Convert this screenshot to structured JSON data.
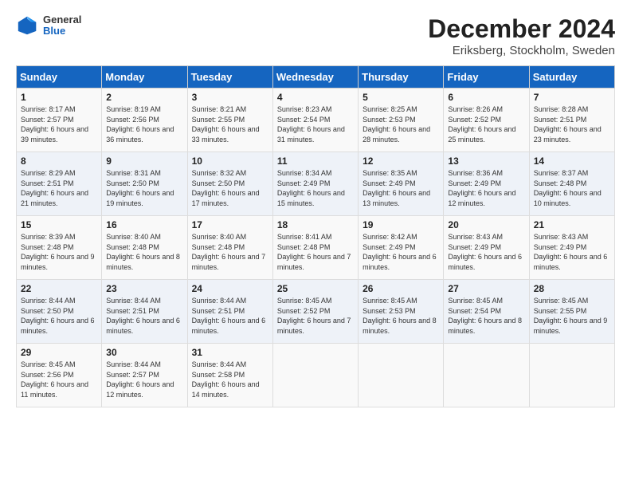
{
  "header": {
    "logo_general": "General",
    "logo_blue": "Blue",
    "main_title": "December 2024",
    "sub_title": "Eriksberg, Stockholm, Sweden"
  },
  "calendar": {
    "days_of_week": [
      "Sunday",
      "Monday",
      "Tuesday",
      "Wednesday",
      "Thursday",
      "Friday",
      "Saturday"
    ],
    "weeks": [
      [
        {
          "day": "1",
          "sunrise": "Sunrise: 8:17 AM",
          "sunset": "Sunset: 2:57 PM",
          "daylight": "Daylight: 6 hours and 39 minutes."
        },
        {
          "day": "2",
          "sunrise": "Sunrise: 8:19 AM",
          "sunset": "Sunset: 2:56 PM",
          "daylight": "Daylight: 6 hours and 36 minutes."
        },
        {
          "day": "3",
          "sunrise": "Sunrise: 8:21 AM",
          "sunset": "Sunset: 2:55 PM",
          "daylight": "Daylight: 6 hours and 33 minutes."
        },
        {
          "day": "4",
          "sunrise": "Sunrise: 8:23 AM",
          "sunset": "Sunset: 2:54 PM",
          "daylight": "Daylight: 6 hours and 31 minutes."
        },
        {
          "day": "5",
          "sunrise": "Sunrise: 8:25 AM",
          "sunset": "Sunset: 2:53 PM",
          "daylight": "Daylight: 6 hours and 28 minutes."
        },
        {
          "day": "6",
          "sunrise": "Sunrise: 8:26 AM",
          "sunset": "Sunset: 2:52 PM",
          "daylight": "Daylight: 6 hours and 25 minutes."
        },
        {
          "day": "7",
          "sunrise": "Sunrise: 8:28 AM",
          "sunset": "Sunset: 2:51 PM",
          "daylight": "Daylight: 6 hours and 23 minutes."
        }
      ],
      [
        {
          "day": "8",
          "sunrise": "Sunrise: 8:29 AM",
          "sunset": "Sunset: 2:51 PM",
          "daylight": "Daylight: 6 hours and 21 minutes."
        },
        {
          "day": "9",
          "sunrise": "Sunrise: 8:31 AM",
          "sunset": "Sunset: 2:50 PM",
          "daylight": "Daylight: 6 hours and 19 minutes."
        },
        {
          "day": "10",
          "sunrise": "Sunrise: 8:32 AM",
          "sunset": "Sunset: 2:50 PM",
          "daylight": "Daylight: 6 hours and 17 minutes."
        },
        {
          "day": "11",
          "sunrise": "Sunrise: 8:34 AM",
          "sunset": "Sunset: 2:49 PM",
          "daylight": "Daylight: 6 hours and 15 minutes."
        },
        {
          "day": "12",
          "sunrise": "Sunrise: 8:35 AM",
          "sunset": "Sunset: 2:49 PM",
          "daylight": "Daylight: 6 hours and 13 minutes."
        },
        {
          "day": "13",
          "sunrise": "Sunrise: 8:36 AM",
          "sunset": "Sunset: 2:49 PM",
          "daylight": "Daylight: 6 hours and 12 minutes."
        },
        {
          "day": "14",
          "sunrise": "Sunrise: 8:37 AM",
          "sunset": "Sunset: 2:48 PM",
          "daylight": "Daylight: 6 hours and 10 minutes."
        }
      ],
      [
        {
          "day": "15",
          "sunrise": "Sunrise: 8:39 AM",
          "sunset": "Sunset: 2:48 PM",
          "daylight": "Daylight: 6 hours and 9 minutes."
        },
        {
          "day": "16",
          "sunrise": "Sunrise: 8:40 AM",
          "sunset": "Sunset: 2:48 PM",
          "daylight": "Daylight: 6 hours and 8 minutes."
        },
        {
          "day": "17",
          "sunrise": "Sunrise: 8:40 AM",
          "sunset": "Sunset: 2:48 PM",
          "daylight": "Daylight: 6 hours and 7 minutes."
        },
        {
          "day": "18",
          "sunrise": "Sunrise: 8:41 AM",
          "sunset": "Sunset: 2:48 PM",
          "daylight": "Daylight: 6 hours and 7 minutes."
        },
        {
          "day": "19",
          "sunrise": "Sunrise: 8:42 AM",
          "sunset": "Sunset: 2:49 PM",
          "daylight": "Daylight: 6 hours and 6 minutes."
        },
        {
          "day": "20",
          "sunrise": "Sunrise: 8:43 AM",
          "sunset": "Sunset: 2:49 PM",
          "daylight": "Daylight: 6 hours and 6 minutes."
        },
        {
          "day": "21",
          "sunrise": "Sunrise: 8:43 AM",
          "sunset": "Sunset: 2:49 PM",
          "daylight": "Daylight: 6 hours and 6 minutes."
        }
      ],
      [
        {
          "day": "22",
          "sunrise": "Sunrise: 8:44 AM",
          "sunset": "Sunset: 2:50 PM",
          "daylight": "Daylight: 6 hours and 6 minutes."
        },
        {
          "day": "23",
          "sunrise": "Sunrise: 8:44 AM",
          "sunset": "Sunset: 2:51 PM",
          "daylight": "Daylight: 6 hours and 6 minutes."
        },
        {
          "day": "24",
          "sunrise": "Sunrise: 8:44 AM",
          "sunset": "Sunset: 2:51 PM",
          "daylight": "Daylight: 6 hours and 6 minutes."
        },
        {
          "day": "25",
          "sunrise": "Sunrise: 8:45 AM",
          "sunset": "Sunset: 2:52 PM",
          "daylight": "Daylight: 6 hours and 7 minutes."
        },
        {
          "day": "26",
          "sunrise": "Sunrise: 8:45 AM",
          "sunset": "Sunset: 2:53 PM",
          "daylight": "Daylight: 6 hours and 8 minutes."
        },
        {
          "day": "27",
          "sunrise": "Sunrise: 8:45 AM",
          "sunset": "Sunset: 2:54 PM",
          "daylight": "Daylight: 6 hours and 8 minutes."
        },
        {
          "day": "28",
          "sunrise": "Sunrise: 8:45 AM",
          "sunset": "Sunset: 2:55 PM",
          "daylight": "Daylight: 6 hours and 9 minutes."
        }
      ],
      [
        {
          "day": "29",
          "sunrise": "Sunrise: 8:45 AM",
          "sunset": "Sunset: 2:56 PM",
          "daylight": "Daylight: 6 hours and 11 minutes."
        },
        {
          "day": "30",
          "sunrise": "Sunrise: 8:44 AM",
          "sunset": "Sunset: 2:57 PM",
          "daylight": "Daylight: 6 hours and 12 minutes."
        },
        {
          "day": "31",
          "sunrise": "Sunrise: 8:44 AM",
          "sunset": "Sunset: 2:58 PM",
          "daylight": "Daylight: 6 hours and 14 minutes."
        },
        null,
        null,
        null,
        null
      ]
    ]
  }
}
